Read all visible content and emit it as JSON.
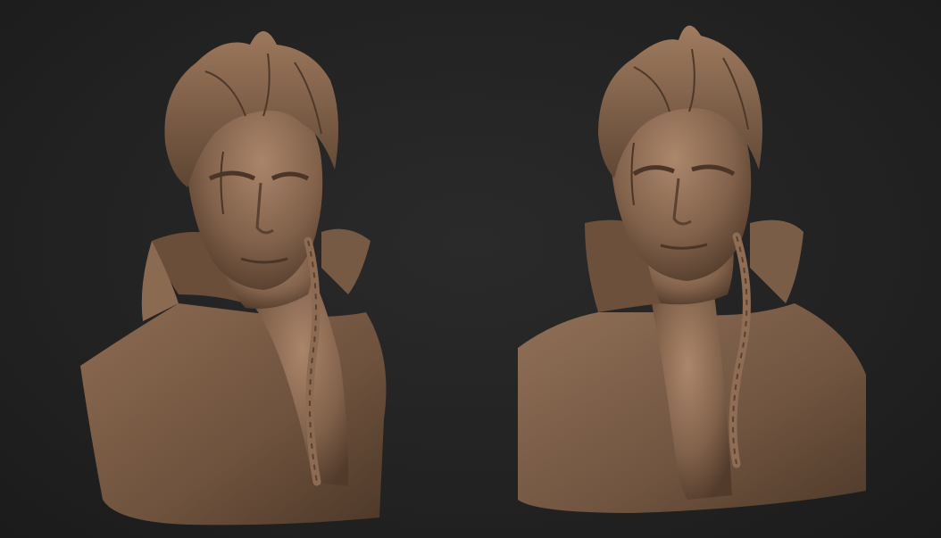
{
  "scene": {
    "background_color": "#242424",
    "material_color": "#7b5c45",
    "material_highlight": "#a88366",
    "material_shadow": "#3e2c20"
  },
  "views": [
    {
      "id": "left",
      "subject": "sculpted-bust",
      "angle": "three-quarter-left"
    },
    {
      "id": "right",
      "subject": "sculpted-bust",
      "angle": "three-quarter-right"
    }
  ]
}
